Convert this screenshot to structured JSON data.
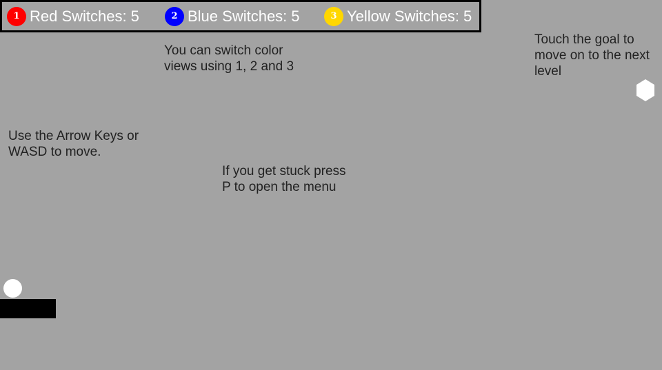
{
  "hud": {
    "switches": [
      {
        "key": "1",
        "label": "Red Switches:",
        "count": "5",
        "color": "#ff0000"
      },
      {
        "key": "2",
        "label": "Blue Switches:",
        "count": "5",
        "color": "#0000ff"
      },
      {
        "key": "3",
        "label": "Yellow Switches:",
        "count": "5",
        "color": "#ffd700"
      }
    ]
  },
  "hints": {
    "color_views": "You can switch color\nviews using 1, 2 and 3",
    "goal": "Touch the goal to\nmove on to the next\nlevel",
    "move": "Use the Arrow Keys or\nWASD to move.",
    "menu": "If you get stuck press\nP to open the menu"
  },
  "colors": {
    "background": "#a3a3a3",
    "hud_border": "#000000",
    "text": "#222222",
    "player": "#ffffff",
    "goal": "#ffffff",
    "platform": "#000000"
  },
  "icons": {
    "goal": "hexagon-icon",
    "player": "circle-icon"
  }
}
